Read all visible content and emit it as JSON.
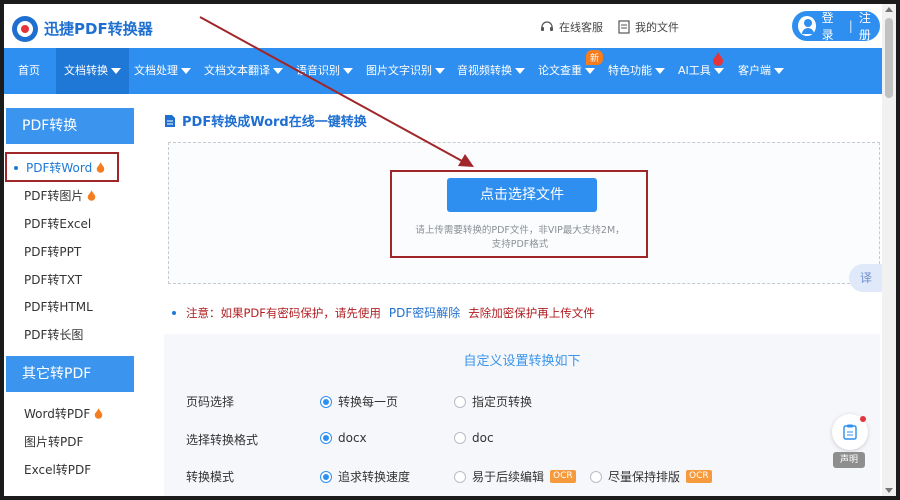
{
  "header": {
    "brand": "迅捷PDF转换器",
    "online_service": "在线客服",
    "my_files": "我的文件",
    "login": "登录",
    "separator": "|",
    "register": "注册"
  },
  "nav": {
    "items": [
      {
        "label": "首页",
        "caret": false
      },
      {
        "label": "文档转换",
        "caret": true
      },
      {
        "label": "文档处理",
        "caret": true
      },
      {
        "label": "文档文本翻译",
        "caret": true
      },
      {
        "label": "语音识别",
        "caret": true
      },
      {
        "label": "图片文字识别",
        "caret": true
      },
      {
        "label": "音视频转换",
        "caret": true
      },
      {
        "label": "论文查重",
        "caret": true
      },
      {
        "label": "特色功能",
        "caret": true
      },
      {
        "label": "AI工具",
        "caret": true
      },
      {
        "label": "客户端",
        "caret": true
      }
    ],
    "new_badge": "新"
  },
  "sidebar": {
    "section1_title": "PDF转换",
    "section1_items": [
      "PDF转Word",
      "PDF转图片",
      "PDF转Excel",
      "PDF转PPT",
      "PDF转TXT",
      "PDF转HTML",
      "PDF转长图"
    ],
    "section2_title": "其它转PDF",
    "section2_items": [
      "Word转PDF",
      "图片转PDF",
      "Excel转PDF"
    ]
  },
  "main": {
    "title": "PDF转换成Word在线一键转换",
    "choose_button": "点击选择文件",
    "hint_line1": "请上传需要转换的PDF文件，非VIP最大支持2M，",
    "hint_line2": "支持PDF格式",
    "translate_fab": "译"
  },
  "notice": {
    "prefix": "注意：如果PDF有密码保护，请先使用",
    "link": "PDF密码解除",
    "suffix": "去除加密保护再上传文件"
  },
  "settings": {
    "title": "自定义设置转换如下",
    "rows": [
      {
        "label": "页码选择",
        "options": [
          {
            "text": "转换每一页",
            "checked": true,
            "ocr": false
          },
          {
            "text": "指定页转换",
            "checked": false,
            "ocr": false
          }
        ]
      },
      {
        "label": "选择转换格式",
        "options": [
          {
            "text": "docx",
            "checked": true,
            "ocr": false
          },
          {
            "text": "doc",
            "checked": false,
            "ocr": false
          }
        ]
      },
      {
        "label": "转换模式",
        "options": [
          {
            "text": "追求转换速度",
            "checked": true,
            "ocr": false
          },
          {
            "text": "易于后续编辑",
            "checked": false,
            "ocr": true
          },
          {
            "text": "尽量保持排版",
            "checked": false,
            "ocr": true
          }
        ]
      }
    ],
    "ocr_label": "OCR"
  },
  "statement": {
    "label": "声明"
  },
  "colors": {
    "primary": "#2e8ff0",
    "annotation": "#a1262a",
    "notice": "#b01e22",
    "ocr_badge": "#f59a3d"
  }
}
